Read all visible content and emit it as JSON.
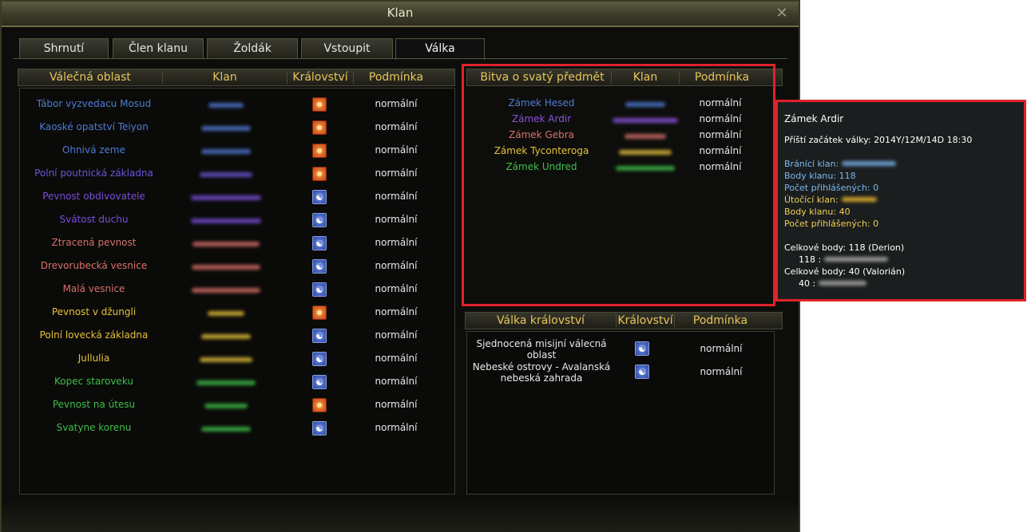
{
  "window": {
    "title": "Klan",
    "close_glyph": "✕"
  },
  "tabs": [
    "Shrnutí",
    "Člen klanu",
    "Žoldák",
    "Vstoupit",
    "Válka"
  ],
  "left_table": {
    "headers": [
      "Válečná oblast",
      "Klan",
      "Království",
      "Podmínka"
    ],
    "rows": [
      {
        "name": "Tábor vyzvedacu Mosud",
        "color": "#4f7bd6",
        "kingdom": "red",
        "cond": "normální"
      },
      {
        "name": "Kaoské opatství Teiyon",
        "color": "#4f7bd6",
        "kingdom": "red",
        "cond": "normální"
      },
      {
        "name": "Ohnivá zeme",
        "color": "#4f7bd6",
        "kingdom": "red",
        "cond": "normální"
      },
      {
        "name": "Polní poutnická základna",
        "color": "#6b55d8",
        "kingdom": "red",
        "cond": "normální"
      },
      {
        "name": "Pevnost obdivovatele",
        "color": "#7a4fd8",
        "kingdom": "blue",
        "cond": "normální"
      },
      {
        "name": "Svátost duchu",
        "color": "#7a4fd8",
        "kingdom": "blue",
        "cond": "normální"
      },
      {
        "name": "Ztracená pevnost",
        "color": "#d8706a",
        "kingdom": "blue",
        "cond": "normální"
      },
      {
        "name": "Drevorubecká vesnice",
        "color": "#d8706a",
        "kingdom": "blue",
        "cond": "normální"
      },
      {
        "name": "Malá vesnice",
        "color": "#d8706a",
        "kingdom": "blue",
        "cond": "normální"
      },
      {
        "name": "Pevnost v džungli",
        "color": "#e6c23a",
        "kingdom": "red",
        "cond": "normální"
      },
      {
        "name": "Polní lovecká základna",
        "color": "#e6c23a",
        "kingdom": "blue",
        "cond": "normální"
      },
      {
        "name": "Jullulia",
        "color": "#e6c23a",
        "kingdom": "blue",
        "cond": "normální"
      },
      {
        "name": "Kopec staroveku",
        "color": "#3fbf4a",
        "kingdom": "blue",
        "cond": "normální"
      },
      {
        "name": "Pevnost na útesu",
        "color": "#3fbf4a",
        "kingdom": "red",
        "cond": "normální"
      },
      {
        "name": "Svatyne korenu",
        "color": "#3fbf4a",
        "kingdom": "blue",
        "cond": "normální"
      }
    ]
  },
  "holy_table": {
    "headers": [
      "Bitva o svatý předmět",
      "Klan",
      "Podmínka"
    ],
    "rows": [
      {
        "name": "Zámek Hesed",
        "color": "#4f7bd6",
        "cond": "normální"
      },
      {
        "name": "Zámek Ardir",
        "color": "#8a52e0",
        "cond": "normální"
      },
      {
        "name": "Zámek Gebra",
        "color": "#d8706a",
        "cond": "normální"
      },
      {
        "name": "Zámek Tyconteroga",
        "color": "#e6c23a",
        "cond": "normální"
      },
      {
        "name": "Zámek Undred",
        "color": "#3fbf4a",
        "cond": "normální"
      }
    ]
  },
  "kingdom_table": {
    "headers": [
      "Válka království",
      "Království",
      "Podmínka"
    ],
    "rows": [
      {
        "line1": "Sjednocená misijní válecná",
        "line2": "oblast",
        "kingdom": "blue",
        "cond": "normální"
      },
      {
        "line1": "Nebeské ostrovy - Avalanská",
        "line2": "nebeská zahrada",
        "kingdom": "blue",
        "cond": "normální"
      }
    ]
  },
  "tooltip": {
    "title": "Zámek Ardir",
    "next_war": "Příští začátek války: 2014Y/12M/14D 18:30",
    "def_clan": "Bránící klan:",
    "def_points": "Body klanu: 118",
    "def_registered": "Počet přihlášených: 0",
    "att_clan": "Útočící klan:",
    "att_points": "Body klanu: 40",
    "att_registered": "Počet přihlášených: 0",
    "total1": "Celkové body: 118 (Derion)",
    "total1_sub": "118 :",
    "total2": "Celkové body: 40 (Valorián)",
    "total2_sub": "40 :"
  },
  "colors": {
    "header_gold": "#e7c45a",
    "highlight_red": "#e0222a",
    "tooltip_blue": "#7ab8f0",
    "tooltip_yellow": "#f0d050"
  },
  "icons": {
    "red_kingdom": "lion-emblem-icon",
    "blue_kingdom": "yin-yang-emblem-icon",
    "close": "close-icon"
  }
}
